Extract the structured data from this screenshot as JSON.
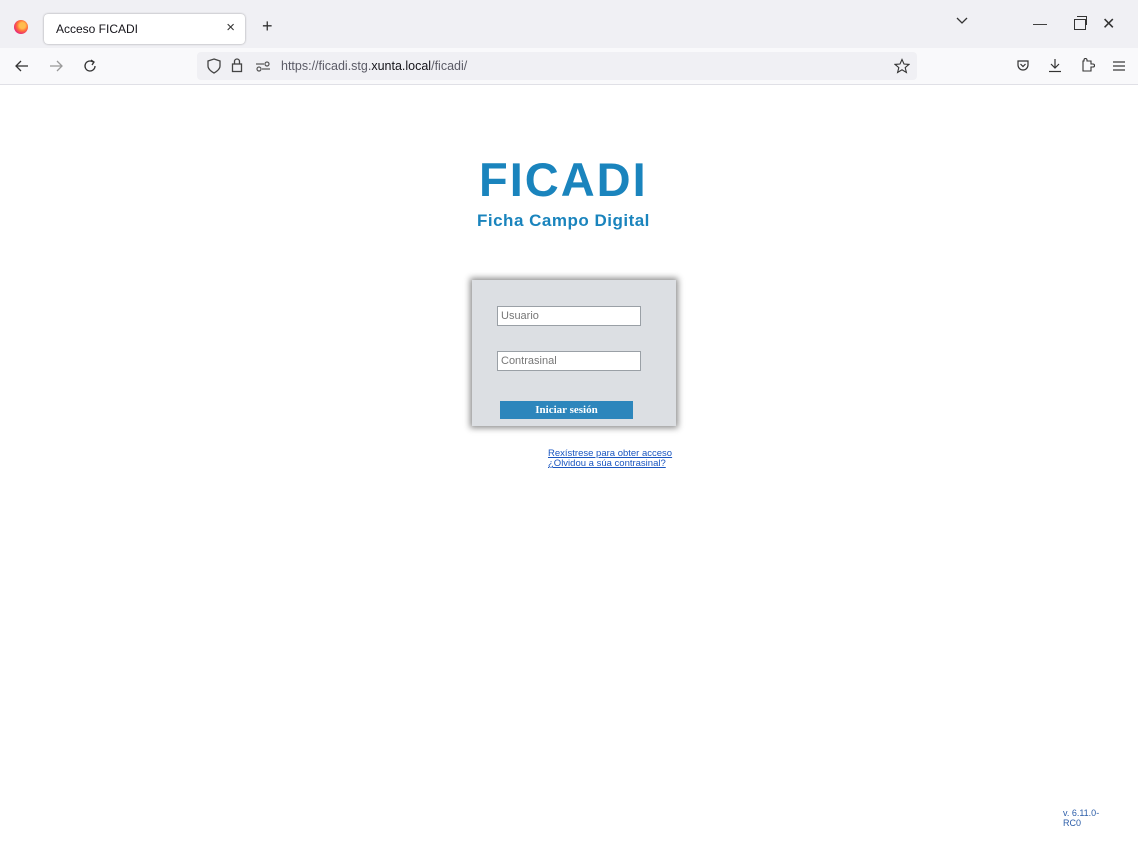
{
  "browser": {
    "tab_title": "Acceso FICADI",
    "tab_close": "×",
    "new_tab": "+",
    "url_prefix": "https://ficadi.stg.",
    "url_host": "xunta.local",
    "url_suffix": "/ficadi/",
    "icons": [
      "firefox-icon",
      "back-icon",
      "forward-icon",
      "reload-icon",
      "shield-icon",
      "lock-icon",
      "permissions-icon",
      "bookmark-star-icon",
      "pocket-icon",
      "download-icon",
      "extensions-icon",
      "menu-icon",
      "tabs-list-icon",
      "minimize-icon",
      "maximize-icon",
      "close-icon"
    ]
  },
  "app": {
    "logo_title": "FICADI",
    "logo_subtitle": "Ficha Campo Digital",
    "brand_color": "#1a84bd"
  },
  "login": {
    "username_placeholder": "Usuario",
    "password_placeholder": "Contrasinal",
    "submit_label": "Iniciar sesión",
    "button_color": "#2d86bc"
  },
  "links": {
    "register": "Rexístrese para obter acceso",
    "forgot_password": "¿Olvidou a súa contrasinal?"
  },
  "footer": {
    "version": "v. 6.11.0-RC0"
  }
}
